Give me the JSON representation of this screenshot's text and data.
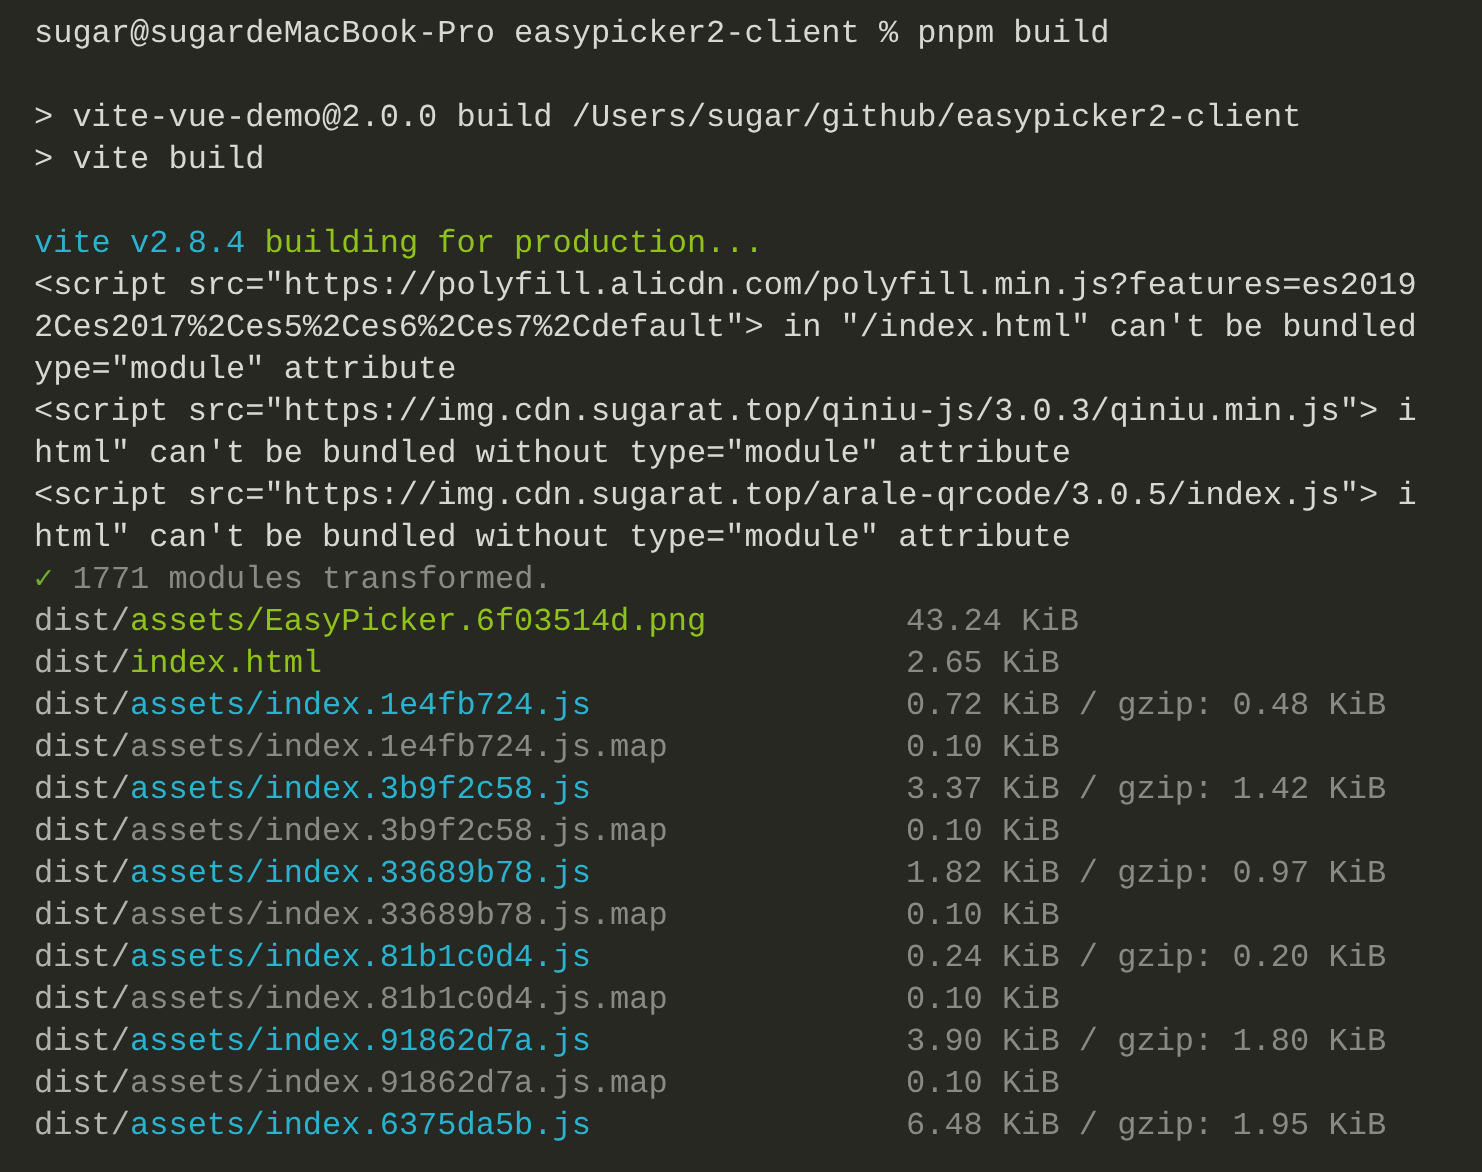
{
  "terminal": {
    "lines": [
      {
        "kind": "prompt",
        "text": "sugar@sugardeMacBook-Pro easypicker2-client % pnpm build"
      },
      {
        "kind": "blank"
      },
      {
        "kind": "plain",
        "text": "> vite-vue-demo@2.0.0 build /Users/sugar/github/easypicker2-client"
      },
      {
        "kind": "plain",
        "text": "> vite build"
      },
      {
        "kind": "blank"
      },
      {
        "kind": "banner",
        "tool": "vite v2.8.4",
        "message": "building for production..."
      },
      {
        "kind": "plain",
        "text": "<script src=\"https://polyfill.alicdn.com/polyfill.min.js?features=es2019"
      },
      {
        "kind": "plain",
        "text": "2Ces2017%2Ces5%2Ces6%2Ces7%2Cdefault\"> in \"/index.html\" can't be bundled"
      },
      {
        "kind": "plain",
        "text": "ype=\"module\" attribute"
      },
      {
        "kind": "plain",
        "text": "<script src=\"https://img.cdn.sugarat.top/qiniu-js/3.0.3/qiniu.min.js\"> i"
      },
      {
        "kind": "plain",
        "text": "html\" can't be bundled without type=\"module\" attribute"
      },
      {
        "kind": "plain",
        "text": "<script src=\"https://img.cdn.sugarat.top/arale-qrcode/3.0.5/index.js\"> i"
      },
      {
        "kind": "plain",
        "text": "html\" can't be bundled without type=\"module\" attribute"
      },
      {
        "kind": "success",
        "mark": "✓",
        "text": "1771 modules transformed."
      },
      {
        "kind": "asset",
        "dir": "dist/",
        "path": "assets/EasyPicker.6f03514d.png",
        "size": "43.24 KiB"
      },
      {
        "kind": "asset",
        "dir": "dist/",
        "path": "index.html",
        "size": "2.65 KiB"
      },
      {
        "kind": "js",
        "dir": "dist/",
        "path": "assets/index.1e4fb724.js",
        "size": "0.72 KiB / gzip: 0.48 KiB"
      },
      {
        "kind": "map",
        "dir": "dist/",
        "path": "assets/index.1e4fb724.js.map",
        "size": "0.10 KiB"
      },
      {
        "kind": "js",
        "dir": "dist/",
        "path": "assets/index.3b9f2c58.js",
        "size": "3.37 KiB / gzip: 1.42 KiB"
      },
      {
        "kind": "map",
        "dir": "dist/",
        "path": "assets/index.3b9f2c58.js.map",
        "size": "0.10 KiB"
      },
      {
        "kind": "js",
        "dir": "dist/",
        "path": "assets/index.33689b78.js",
        "size": "1.82 KiB / gzip: 0.97 KiB"
      },
      {
        "kind": "map",
        "dir": "dist/",
        "path": "assets/index.33689b78.js.map",
        "size": "0.10 KiB"
      },
      {
        "kind": "js",
        "dir": "dist/",
        "path": "assets/index.81b1c0d4.js",
        "size": "0.24 KiB / gzip: 0.20 KiB"
      },
      {
        "kind": "map",
        "dir": "dist/",
        "path": "assets/index.81b1c0d4.js.map",
        "size": "0.10 KiB"
      },
      {
        "kind": "js",
        "dir": "dist/",
        "path": "assets/index.91862d7a.js",
        "size": "3.90 KiB / gzip: 1.80 KiB"
      },
      {
        "kind": "map",
        "dir": "dist/",
        "path": "assets/index.91862d7a.js.map",
        "size": "0.10 KiB"
      },
      {
        "kind": "js",
        "dir": "dist/",
        "path": "assets/index.6375da5b.js",
        "size": "6.48 KiB / gzip: 1.95 KiB"
      }
    ]
  }
}
